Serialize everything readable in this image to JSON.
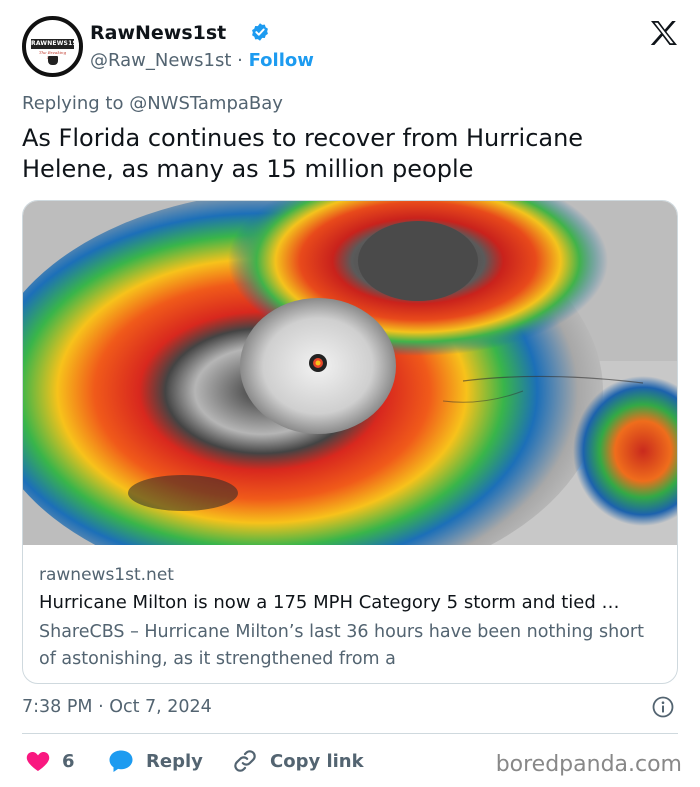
{
  "author": {
    "name": "RawNews1st",
    "handle": "@Raw_News1st",
    "separator": "·",
    "follow_label": "Follow",
    "avatar_logo_text": "RAWNEWS1ST",
    "avatar_sub_text": "The Breaking News"
  },
  "tweet": {
    "replying_to": "Replying to @NWSTampaBay",
    "text": "As Florida continues to recover from Hurricane Helene, as many as 15 million people",
    "timestamp": "7:38 PM · Oct 7, 2024"
  },
  "card": {
    "domain": "rawnews1st.net",
    "title": "Hurricane Milton is now a 175 MPH Category 5 storm and tied …",
    "description": "ShareCBS – Hurricane Milton’s last 36 hours have been nothing short of astonishing, as it strengthened from a"
  },
  "actions": {
    "like_count": "6",
    "reply_label": "Reply",
    "copy_label": "Copy link"
  },
  "watermark": "boredpanda.com",
  "icons": [
    "verified-badge-icon",
    "x-logo-icon",
    "info-icon",
    "heart-icon",
    "reply-bubble-icon",
    "link-icon"
  ],
  "colors": {
    "accent": "#1d9bf0",
    "like": "#f91880",
    "secondary_text": "#536471",
    "primary_text": "#0f1419",
    "border": "#cfd9de"
  }
}
